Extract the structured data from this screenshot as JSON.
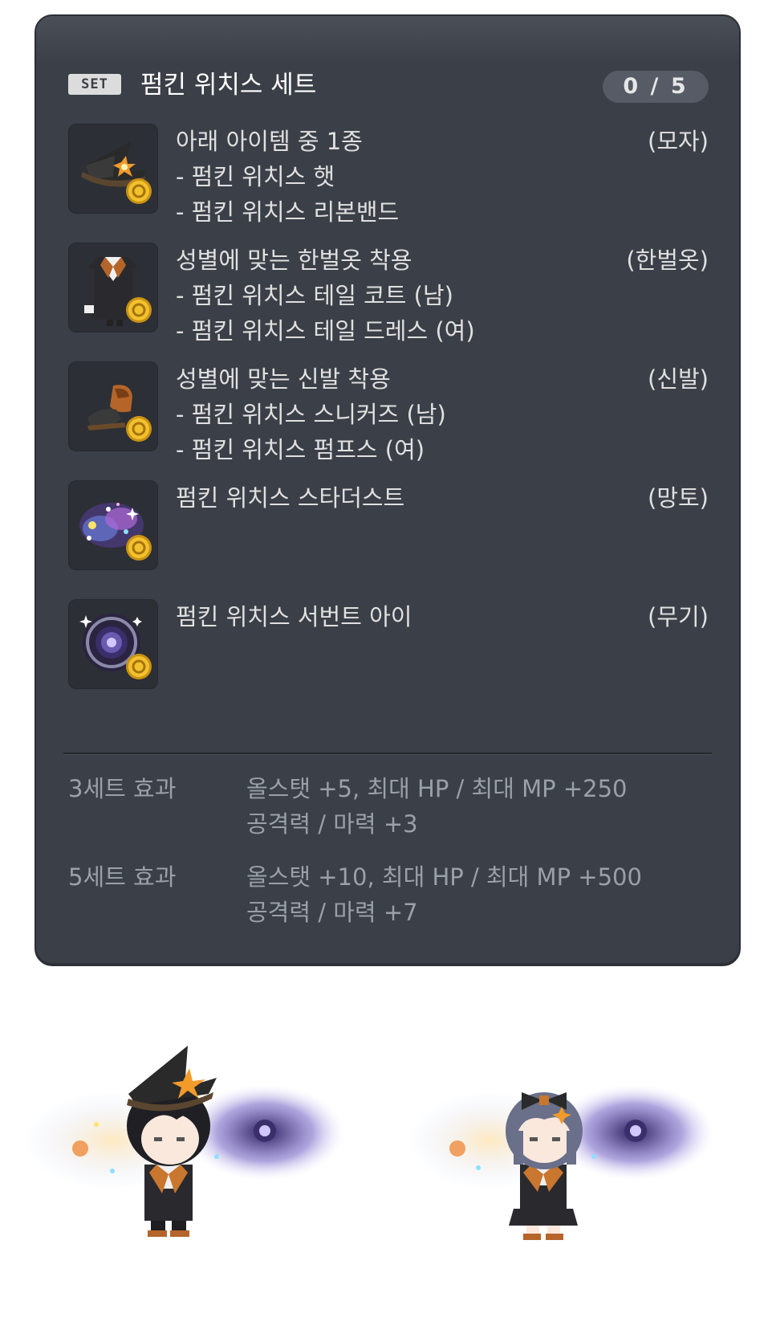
{
  "set": {
    "badge": "SET",
    "title": "펌킨 위치스 세트",
    "counter": "0 / 5"
  },
  "items": [
    {
      "icon": "witch-hat-icon",
      "category": "(모자)",
      "lines": [
        "아래 아이템 중 1종",
        "- 펌킨 위치스 햇",
        "- 펌킨 위치스 리본밴드"
      ]
    },
    {
      "icon": "suit-icon",
      "category": "(한벌옷)",
      "lines": [
        "성별에 맞는 한벌옷 착용",
        "- 펌킨 위치스 테일 코트 (남)",
        "- 펌킨 위치스 테일 드레스 (여)"
      ]
    },
    {
      "icon": "shoes-icon",
      "category": "(신발)",
      "lines": [
        "성별에 맞는 신발 착용",
        "- 펌킨 위치스 스니커즈 (남)",
        "- 펌킨 위치스 펌프스 (여)"
      ]
    },
    {
      "icon": "stardust-cape-icon",
      "category": "(망토)",
      "lines": [
        "펌킨 위치스 스타더스트"
      ]
    },
    {
      "icon": "servant-eye-icon",
      "category": "(무기)",
      "lines": [
        "펌킨 위치스 서번트 아이"
      ]
    }
  ],
  "effects": [
    {
      "label": "3세트 효과",
      "values": [
        "올스탯 +5, 최대 HP / 최대 MP  +250",
        "공격력 / 마력  +3"
      ]
    },
    {
      "label": "5세트 효과",
      "values": [
        "올스탯 +10, 최대 HP / 최대 MP  +500",
        "공격력 / 마력  +7"
      ]
    }
  ],
  "colors": {
    "panel": "#3b3f47",
    "slot": "#2c2f35",
    "text": "#e0e0e0",
    "effect_text": "#9aa0a8",
    "coin": "#f2c12e",
    "accent_orange": "#e8872a"
  },
  "previews": [
    {
      "name": "male-character-preview"
    },
    {
      "name": "female-character-preview"
    }
  ]
}
